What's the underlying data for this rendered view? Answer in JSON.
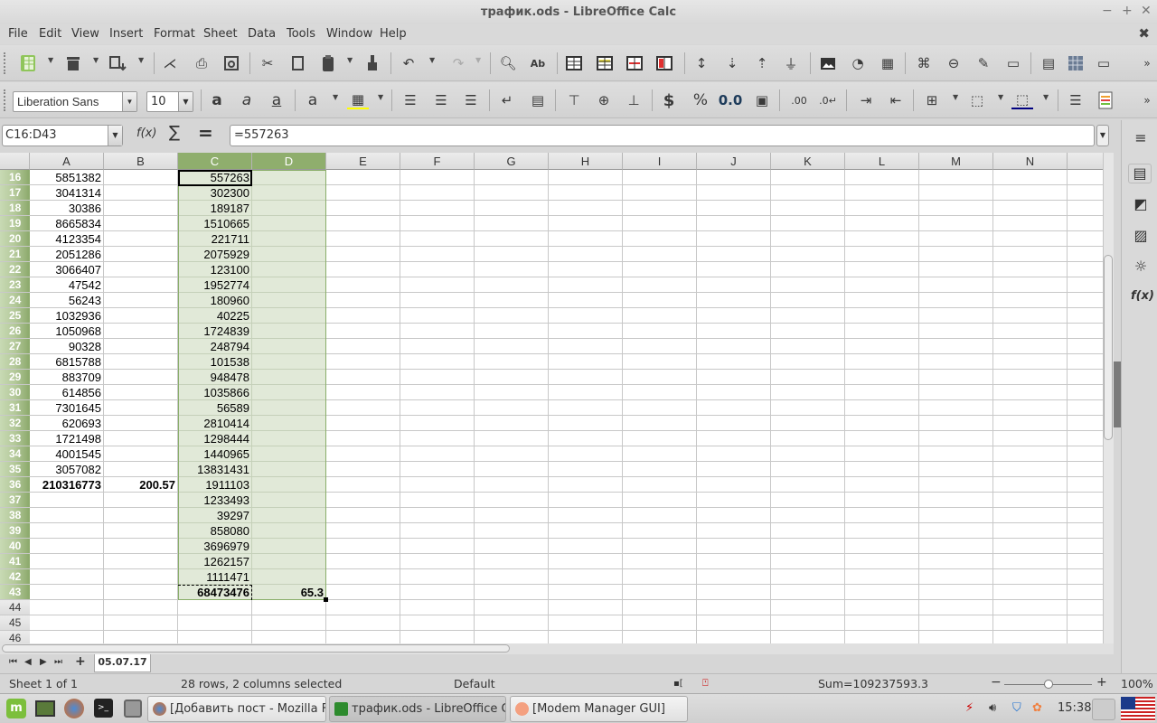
{
  "window": {
    "title": "трафик.ods - LibreOffice Calc",
    "minimize": "−",
    "maximize": "+",
    "close": "✕",
    "close_document": "✖"
  },
  "menu": [
    "File",
    "Edit",
    "View",
    "Insert",
    "Format",
    "Sheet",
    "Data",
    "Tools",
    "Window",
    "Help"
  ],
  "toolbar_formatting": {
    "font_name": "Liberation Sans",
    "font_size": "10",
    "font_color": "#8b0000",
    "highlight_color": "#ffff00",
    "border_color": "#000080"
  },
  "formula_bar": {
    "name_box": "C16:D43",
    "function_wizard": "f(x)",
    "sum_symbol": "∑",
    "equals_symbol": "=",
    "formula": "=557263"
  },
  "columns": [
    "A",
    "B",
    "C",
    "D",
    "E",
    "F",
    "G",
    "H",
    "I",
    "J",
    "K",
    "L",
    "M",
    "N"
  ],
  "selected_columns": [
    "C",
    "D"
  ],
  "rows": [
    {
      "n": "16",
      "A": "5851382",
      "B": "",
      "C": "557263",
      "D": ""
    },
    {
      "n": "17",
      "A": "3041314",
      "B": "",
      "C": "302300",
      "D": ""
    },
    {
      "n": "18",
      "A": "30386",
      "B": "",
      "C": "189187",
      "D": ""
    },
    {
      "n": "19",
      "A": "8665834",
      "B": "",
      "C": "1510665",
      "D": ""
    },
    {
      "n": "20",
      "A": "4123354",
      "B": "",
      "C": "221711",
      "D": ""
    },
    {
      "n": "21",
      "A": "2051286",
      "B": "",
      "C": "2075929",
      "D": ""
    },
    {
      "n": "22",
      "A": "3066407",
      "B": "",
      "C": "123100",
      "D": ""
    },
    {
      "n": "23",
      "A": "47542",
      "B": "",
      "C": "1952774",
      "D": ""
    },
    {
      "n": "24",
      "A": "56243",
      "B": "",
      "C": "180960",
      "D": ""
    },
    {
      "n": "25",
      "A": "1032936",
      "B": "",
      "C": "40225",
      "D": ""
    },
    {
      "n": "26",
      "A": "1050968",
      "B": "",
      "C": "1724839",
      "D": ""
    },
    {
      "n": "27",
      "A": "90328",
      "B": "",
      "C": "248794",
      "D": ""
    },
    {
      "n": "28",
      "A": "6815788",
      "B": "",
      "C": "101538",
      "D": ""
    },
    {
      "n": "29",
      "A": "883709",
      "B": "",
      "C": "948478",
      "D": ""
    },
    {
      "n": "30",
      "A": "614856",
      "B": "",
      "C": "1035866",
      "D": ""
    },
    {
      "n": "31",
      "A": "7301645",
      "B": "",
      "C": "56589",
      "D": ""
    },
    {
      "n": "32",
      "A": "620693",
      "B": "",
      "C": "2810414",
      "D": ""
    },
    {
      "n": "33",
      "A": "1721498",
      "B": "",
      "C": "1298444",
      "D": ""
    },
    {
      "n": "34",
      "A": "4001545",
      "B": "",
      "C": "1440965",
      "D": ""
    },
    {
      "n": "35",
      "A": "3057082",
      "B": "",
      "C": "13831431",
      "D": ""
    },
    {
      "n": "36",
      "A": "210316773",
      "B": "200.57",
      "C": "1911103",
      "D": "",
      "bold": [
        "A",
        "B"
      ]
    },
    {
      "n": "37",
      "A": "",
      "B": "",
      "C": "1233493",
      "D": ""
    },
    {
      "n": "38",
      "A": "",
      "B": "",
      "C": "39297",
      "D": ""
    },
    {
      "n": "39",
      "A": "",
      "B": "",
      "C": "858080",
      "D": ""
    },
    {
      "n": "40",
      "A": "",
      "B": "",
      "C": "3696979",
      "D": ""
    },
    {
      "n": "41",
      "A": "",
      "B": "",
      "C": "1262157",
      "D": ""
    },
    {
      "n": "42",
      "A": "",
      "B": "",
      "C": "1111471",
      "D": ""
    },
    {
      "n": "43",
      "A": "",
      "B": "",
      "C": "68473476",
      "D": "65.3",
      "bold": [
        "C",
        "D"
      ]
    },
    {
      "n": "44",
      "A": "",
      "B": "",
      "C": "",
      "D": ""
    },
    {
      "n": "45",
      "A": "",
      "B": "",
      "C": "",
      "D": ""
    },
    {
      "n": "46",
      "A": "",
      "B": "",
      "C": "",
      "D": ""
    }
  ],
  "selection": {
    "first_row": "16",
    "last_row": "43"
  },
  "sheet_tabs": [
    "05.07.17"
  ],
  "status_bar": {
    "sheet": "Sheet 1 of 1",
    "selection_info": "28 rows, 2 columns selected",
    "page_style": "Default",
    "sum": "Sum=109237593.3",
    "zoom": "100%",
    "zoom_level_percent": 100
  },
  "taskbar": {
    "windows": [
      {
        "label": "[Добавить пост - Mozilla Fir...",
        "active": false
      },
      {
        "label": "трафик.ods - LibreOffice Calc",
        "active": true
      },
      {
        "label": "[Modem Manager GUI]",
        "active": false
      }
    ],
    "clock": "15:38"
  }
}
